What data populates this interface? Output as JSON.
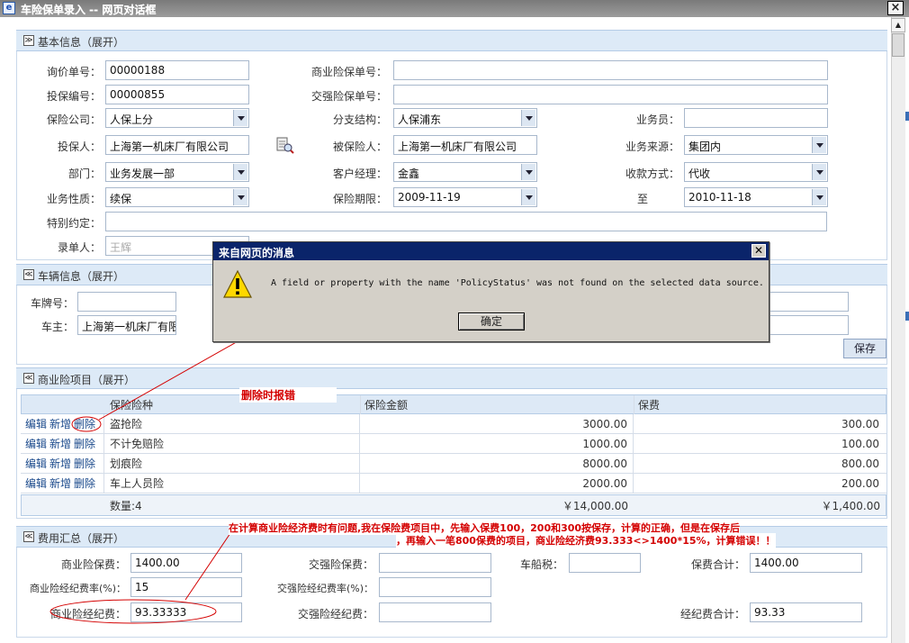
{
  "window": {
    "title": "车险保单录入 -- 网页对话框",
    "close_glyph": "×"
  },
  "basic": {
    "title": "基本信息（展开）",
    "inquiry_no_label": "询价单号：",
    "inquiry_no": "00000188",
    "commercial_policy_label": "商业险保单号：",
    "commercial_policy": "",
    "proposal_no_label": "投保编号：",
    "proposal_no": "00000855",
    "compulsory_policy_label": "交强险保单号：",
    "compulsory_policy": "",
    "insurer_label": "保险公司：",
    "insurer": "人保上分",
    "branch_label": "分支结构：",
    "branch": "人保浦东",
    "salesperson_label": "业务员：",
    "salesperson": "",
    "applicant_label": "投保人：",
    "applicant": "上海第一机床厂有限公司",
    "insured_label": "被保险人：",
    "insured": "上海第一机床厂有限公司",
    "source_label": "业务来源：",
    "source": "集团内",
    "dept_label": "部门：",
    "dept": "业务发展一部",
    "manager_label": "客户经理：",
    "manager": "金鑫",
    "payment_label": "收款方式：",
    "payment": "代收",
    "nature_label": "业务性质：",
    "nature": "续保",
    "period_label": "保险期限：",
    "period_start": "2009-11-19",
    "period_to": "至",
    "period_end": "2010-11-18",
    "special_label": "特别约定：",
    "special": "",
    "recorder_label": "录单人：",
    "recorder": "王辉"
  },
  "vehicle": {
    "title": "车辆信息（展开）",
    "plate_label": "车牌号：",
    "plate": "",
    "owner_label": "车主：",
    "owner": "上海第一机床厂有限",
    "save": "保存"
  },
  "commercial": {
    "title": "商业险项目（展开）",
    "columns": [
      "保险险种",
      "保险金额",
      "保费"
    ],
    "actions": {
      "edit": "编辑",
      "add": "新增",
      "delete": "删除"
    },
    "rows": [
      {
        "type": "盗抢险",
        "amount": "3000.00",
        "premium": "300.00"
      },
      {
        "type": "不计免赔险",
        "amount": "1000.00",
        "premium": "100.00"
      },
      {
        "type": "划痕险",
        "amount": "8000.00",
        "premium": "800.00"
      },
      {
        "type": "车上人员险",
        "amount": "2000.00",
        "premium": "200.00"
      }
    ],
    "count": "数量:4",
    "total_amount": "￥14,000.00",
    "total_premium": "￥1,400.00"
  },
  "fees": {
    "title": "费用汇总（展开）",
    "commercial_premium_label": "商业险保费：",
    "commercial_premium": "1400.00",
    "compulsory_premium_label": "交强险保费：",
    "compulsory_premium": "",
    "vehicle_tax_label": "车船税：",
    "vehicle_tax": "",
    "premium_total_label": "保费合计：",
    "premium_total": "1400.00",
    "commercial_rate_label": "商业险经纪费率(%)：",
    "commercial_rate": "15",
    "compulsory_rate_label": "交强险经纪费率(%)：",
    "compulsory_rate": "",
    "commercial_fee_label": "商业险经纪费：",
    "commercial_fee": "93.33333",
    "compulsory_fee_label": "交强险经纪费：",
    "compulsory_fee": "",
    "fee_total_label": "经纪费合计：",
    "fee_total": "93.33"
  },
  "dialog": {
    "title": "来自网页的消息",
    "message": "A field or property with the name 'PolicyStatus' was not found on the selected data source.",
    "ok": "确定"
  },
  "annotations": {
    "delete_error": "删除时报错",
    "calc_line1": "在计算商业险经济费时有问题,我在保险费项目中，先输入保费100，200和300按保存，计算的正确，但是在保存后",
    "calc_line2": "，再输入一笔800保费的项目，商业险经济费93.333<>1400*15%，计算错误！！",
    "color": "#d40000"
  }
}
